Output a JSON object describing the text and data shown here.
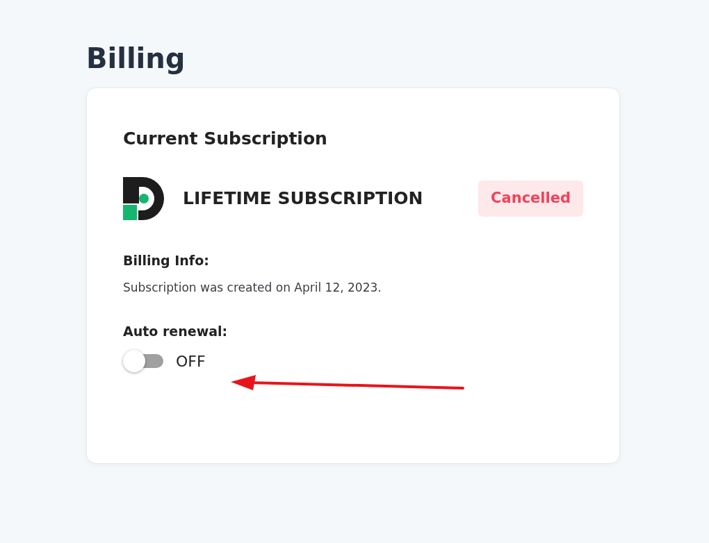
{
  "page_title": "Billing",
  "subscription_card": {
    "title": "Current Subscription",
    "plan_name": "LIFETIME SUBSCRIPTION",
    "status": {
      "label": "Cancelled",
      "kind": "cancelled"
    },
    "billing_info": {
      "label": "Billing Info:",
      "text": "Subscription was created on April 12, 2023."
    },
    "auto_renewal": {
      "label": "Auto renewal:",
      "on": false,
      "state_label": "OFF"
    }
  }
}
